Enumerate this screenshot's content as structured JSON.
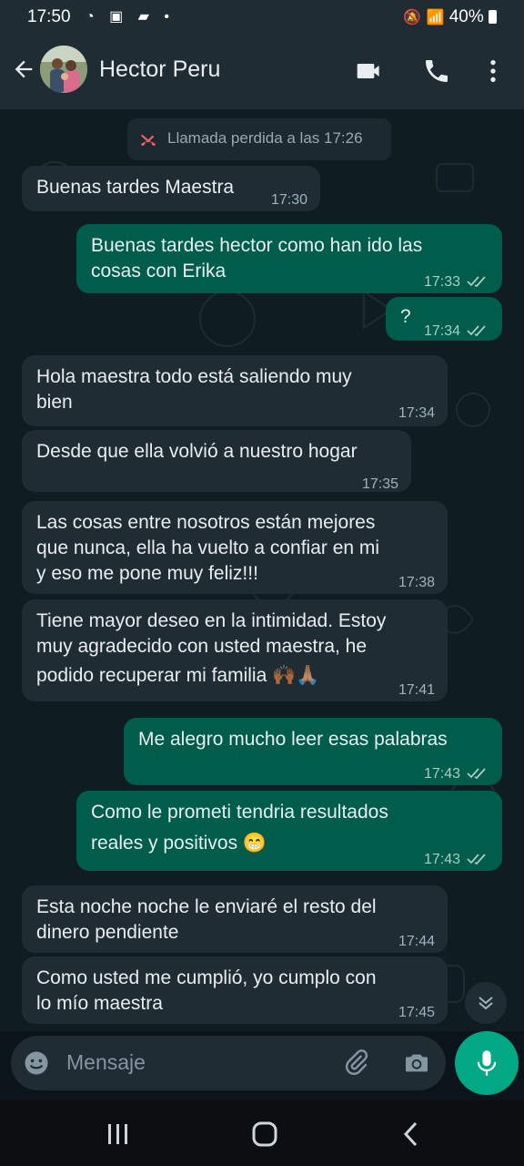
{
  "status_bar": {
    "time": "17:50",
    "battery": "40%"
  },
  "header": {
    "contact_name": "Hector Peru"
  },
  "system_message": "Llamada perdida a las 17:26",
  "messages": [
    {
      "dir": "in",
      "lines": [
        "Buenas tardes Maestra"
      ],
      "time": "17:30"
    },
    {
      "dir": "out",
      "lines": [
        "Buenas tardes hector como han ido las",
        "cosas con Erika"
      ],
      "time": "17:33"
    },
    {
      "dir": "out",
      "lines": [
        "?"
      ],
      "time": "17:34"
    },
    {
      "dir": "in",
      "lines": [
        "Hola maestra todo está saliendo muy",
        "bien"
      ],
      "time": "17:34"
    },
    {
      "dir": "in",
      "lines": [
        "Desde que ella volvió a nuestro hogar"
      ],
      "time": "17:35"
    },
    {
      "dir": "in",
      "lines": [
        "Las cosas entre nosotros están mejores",
        "que nunca, ella ha vuelto a confiar en mi",
        "y eso me pone muy feliz!!!"
      ],
      "time": "17:38"
    },
    {
      "dir": "in",
      "lines": [
        "Tiene mayor deseo en la intimidad. Estoy",
        "muy agradecido con usted maestra, he",
        "podido recuperar mi familia 🙌🏾🙏🏽"
      ],
      "time": "17:41"
    },
    {
      "dir": "out",
      "lines": [
        "Me alegro mucho leer esas palabras"
      ],
      "time": "17:43"
    },
    {
      "dir": "out",
      "lines": [
        "Como le prometi tendria resultados",
        "reales y positivos 😁"
      ],
      "time": "17:43"
    },
    {
      "dir": "in",
      "lines": [
        "Esta noche noche le enviaré el resto del",
        "dinero pendiente"
      ],
      "time": "17:44"
    },
    {
      "dir": "in",
      "lines": [
        "Como usted me cumplió, yo cumplo con",
        "lo mío maestra"
      ],
      "time": "17:45"
    }
  ],
  "composer": {
    "placeholder": "Mensaje"
  },
  "colors": {
    "incoming": "#1f2c34",
    "outgoing": "#005c4b",
    "accent": "#00a884",
    "missed_call": "#f15c6d"
  },
  "icons": [
    "back-arrow",
    "video-call",
    "phone",
    "more-vert",
    "emoji",
    "attach",
    "camera",
    "mic",
    "scroll-down",
    "missed-call"
  ]
}
